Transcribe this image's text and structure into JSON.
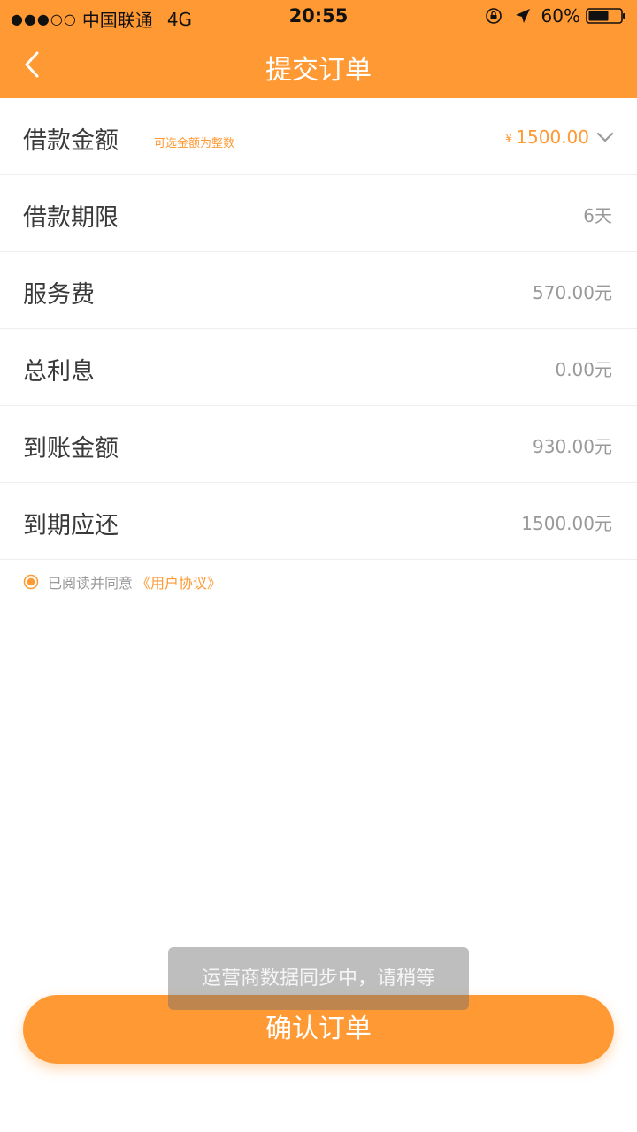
{
  "status_bar": {
    "signal": "●●●○○",
    "carrier": "中国联通",
    "network": "4G",
    "time": "20:55",
    "battery_percent": "60%"
  },
  "header": {
    "title": "提交订单",
    "back_icon": "chevron-left-icon",
    "bg_color": "#FF9933"
  },
  "loan": {
    "amount_label": "借款金额",
    "amount_hint": "可选金额为整数",
    "currency_symbol": "¥",
    "amount_value": "1500.00",
    "term_label": "借款期限",
    "term_value": "6天",
    "service_fee_label": "服务费",
    "service_fee_value": "570.00元",
    "interest_label": "总利息",
    "interest_value": "0.00元",
    "received_label": "到账金额",
    "received_value": "930.00元",
    "repay_label": "到期应还",
    "repay_value": "1500.00元"
  },
  "agreement": {
    "text": "已阅读并同意",
    "link": "《用户协议》",
    "checked": true
  },
  "confirm_button": "确认订单",
  "toast": "运营商数据同步中，请稍等",
  "colors": {
    "accent": "#FF9933",
    "muted_text": "#999999"
  }
}
